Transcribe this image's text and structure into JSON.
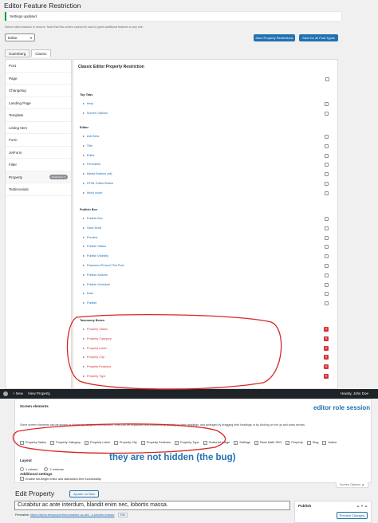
{
  "top": {
    "page_title": "Editor Feature Restriction",
    "notice": "Settings updated.",
    "intro": "Select editor features to remove. Note that this screen cannot be used to grant additional features to any role.",
    "role_select": "Editor",
    "save_button": "Save Property Restrictions",
    "save_all_button": "Save for all Post Types",
    "tabs": [
      "Gutenberg",
      "Classic"
    ],
    "sidebar": [
      {
        "label": "Post"
      },
      {
        "label": "Page"
      },
      {
        "label": "Changelog"
      },
      {
        "label": "Landing Page"
      },
      {
        "label": "Template"
      },
      {
        "label": "Listing Item"
      },
      {
        "label": "Form"
      },
      {
        "label": "JetForm"
      },
      {
        "label": "Filter"
      },
      {
        "label": "Property",
        "badge": "Restricted: 6"
      },
      {
        "label": "Testimonials"
      }
    ],
    "main_title": "Classic Editor Property Restriction",
    "sections": {
      "top_tabs": {
        "heading": "Top Tabs",
        "items": [
          "Help",
          "Screen Options"
        ]
      },
      "editor": {
        "heading": "Editor",
        "items": [
          "Add New",
          "Title",
          "Editor",
          "Permalink",
          "Media Buttons (all)",
          "HTML Editor Button",
          "Word count"
        ]
      },
      "publish_box": {
        "heading": "Publish Box",
        "items": [
          "Publish Box",
          "Save Draft",
          "Preview",
          "Publish Status",
          "Publish Visibility",
          "Password Protect This Post",
          "Publish Actions",
          "Publish Schedule",
          "Date",
          "Publish"
        ]
      },
      "taxonomy_boxes": {
        "heading": "Taxonomy Boxes",
        "items": [
          "Property Status",
          "Property Category",
          "Property Label",
          "Property City",
          "Property Features",
          "Property Type"
        ]
      }
    }
  },
  "bottom": {
    "adminbar": {
      "new": "+ New",
      "view": "View Property",
      "howdy": "Howdy, John Doe"
    },
    "screen_elements_heading": "Screen elements",
    "screen_elements_desc": "Some screen elements can be shown or hidden by using the checkboxes. They can be expanded and collapsed by clicking on their headings, and arranged by dragging their headings or by clicking on the up and down arrows.",
    "checkboxes": [
      {
        "label": "Property Status",
        "checked": true
      },
      {
        "label": "Property Category",
        "checked": true
      },
      {
        "label": "Property Label",
        "checked": true
      },
      {
        "label": "Property City",
        "checked": true
      },
      {
        "label": "Property Features",
        "checked": true
      },
      {
        "label": "Property Type",
        "checked": true
      },
      {
        "label": "Featured image",
        "checked": true
      },
      {
        "label": "Settings",
        "checked": true
      },
      {
        "label": "Rank Math SEO",
        "checked": true
      },
      {
        "label": "Property",
        "checked": true
      },
      {
        "label": "Slug",
        "checked": false
      },
      {
        "label": "Author",
        "checked": true
      }
    ],
    "layout_heading": "Layout",
    "layout_options": [
      {
        "label": "1 column",
        "selected": false
      },
      {
        "label": "2 columns",
        "selected": true
      }
    ],
    "additional_heading": "Additional settings",
    "fullheight_label": "Enable full-height editor and distraction-free functionality.",
    "screen_options_tab": "Screen Options ▲",
    "edit_title": "Edit Property",
    "add_new_button": "Ajouter un Bien",
    "title_value": "Curabitur ac ante interdum, blandit enim nec, lobortis massa.",
    "permalink_label": "Permalink:",
    "permalink_url": "https://alpha.test/properties/curabitur-ac-ant...s-lobortis-massa/",
    "permalink_edit": "Edit",
    "publish_title": "Publish",
    "preview_changes": "Preview Changes"
  },
  "annotations": {
    "role_session": "editor role session",
    "bug_note": "they are not hidden (the bug)"
  },
  "colors": {
    "accent": "#2271b1",
    "annotation_red": "#d62828",
    "adminbar": "#1d2327"
  }
}
